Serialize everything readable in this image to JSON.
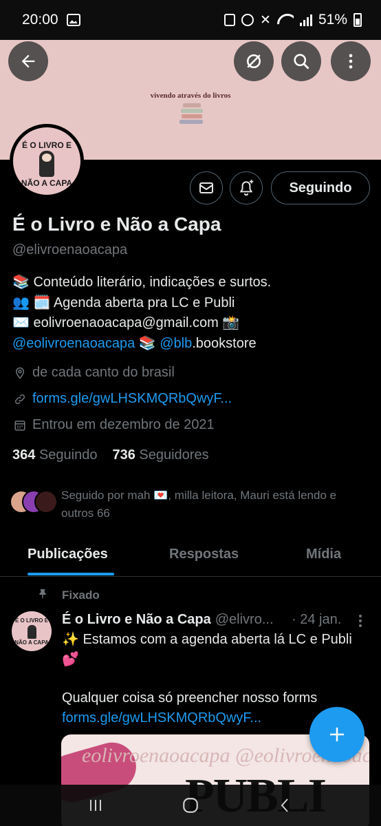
{
  "status_bar": {
    "time": "20:00",
    "battery": "51%"
  },
  "banner": {
    "tagline": "vivendo através do livros"
  },
  "avatar": {
    "line1": "É O LIVRO E",
    "line2": "NÃO A CAPA"
  },
  "header_actions": {
    "follow_label": "Seguindo"
  },
  "profile": {
    "name": "É o Livro e Não a Capa",
    "handle": "@elivroenaoacapa",
    "bio": {
      "line1": "📚 Conteúdo literário, indicações e surtos.",
      "line2": "👥       🗓️ Agenda aberta pra LC e Publi",
      "line3": "✉️ eolivroenaoacapa@gmail.com    📸",
      "line4_link1": "@eolivroenaoacapa",
      "line4_sep": " 📚 ",
      "line4_link2": "@blb",
      "line4_tail": ".bookstore"
    },
    "location": "de cada canto do brasil",
    "website": "forms.gle/gwLHSKMQRbQwyF...",
    "joined": "Entrou em dezembro de 2021",
    "following_count": "364",
    "following_label": "Seguindo",
    "followers_count": "736",
    "followers_label": "Seguidores",
    "followed_by": "Seguido por mah 💌, milla leitora, Mauri está lendo e outros 66"
  },
  "tabs": [
    {
      "label": "Publicações",
      "active": true
    },
    {
      "label": "Respostas",
      "active": false
    },
    {
      "label": "Mídia",
      "active": false
    }
  ],
  "pinned_post": {
    "pinned_label": "Fixado",
    "author": "É o Livro e Não a Capa",
    "handle": "@elivro...",
    "date": "· 24 jan.",
    "avatar_line1": "É O LIVRO E",
    "avatar_line2": "NÃO A CAPA",
    "text_line1": "✨ Estamos com a agenda aberta lá LC e Publi 💕",
    "text_line2": "Qualquer coisa só preencher nosso forms",
    "link": "forms.gle/gwLHSKMQRbQwyF...",
    "image_watermark": "eolivroenaoacapa @eolivroenaoacapa",
    "image_text": "PUBLI"
  },
  "colors": {
    "accent": "#1d9bf0",
    "banner": "#e7c7c5",
    "muted": "#71767b"
  }
}
